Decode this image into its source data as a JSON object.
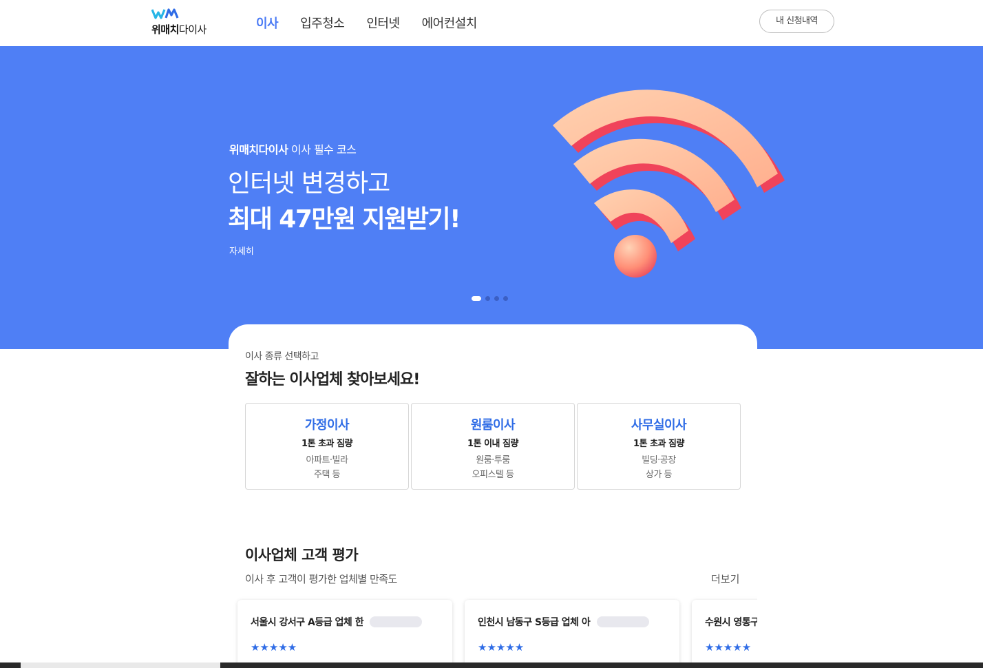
{
  "header": {
    "logo_bold": "위매치",
    "logo_rest": "다이사",
    "nav": [
      {
        "label": "이사",
        "active": true
      },
      {
        "label": "입주청소",
        "active": false
      },
      {
        "label": "인터넷",
        "active": false
      },
      {
        "label": "에어컨설치",
        "active": false
      }
    ],
    "my_button": "내 신청내역"
  },
  "hero": {
    "eyebrow_bold": "위매치다이사",
    "eyebrow_rest": " 이사 필수 코스",
    "line1": "인터넷 변경하고",
    "line2": "최대 47만원 지원받기!",
    "more": "자세히",
    "slides_total": 4,
    "slide_active": 1,
    "background": "#4f7ff5",
    "image": "wifi-3d-icon"
  },
  "moving_types": {
    "subtitle": "이사 종류 선택하고",
    "title": "잘하는 이사업체 찾아보세요!",
    "cards": [
      {
        "name": "가정이사",
        "load": "1톤 초과 짐량",
        "desc1": "아파트·빌라",
        "desc2": "주택 등"
      },
      {
        "name": "원룸이사",
        "load": "1톤 이내 짐량",
        "desc1": "원룸·투룸",
        "desc2": "오피스텔 등"
      },
      {
        "name": "사무실이사",
        "load": "1톤 초과 짐량",
        "desc1": "빌딩·공장",
        "desc2": "상가 등"
      }
    ]
  },
  "reviews": {
    "title": "이사업체 고객 평가",
    "subtitle": "이사 후 고객이 평가한 업체별 만족도",
    "more": "더보기",
    "items": [
      {
        "name": "서울시 강서구 A등급 업체 한",
        "stars": "★★★★★"
      },
      {
        "name": "인천시 남동구 S등급 업체 아",
        "stars": "★★★★★"
      },
      {
        "name": "수원시 영통구",
        "stars": "★★★★★"
      }
    ]
  },
  "colors": {
    "accent": "#4b7bf5",
    "hero_bg": "#4f7ff5",
    "card_title": "#2f6ce6"
  }
}
